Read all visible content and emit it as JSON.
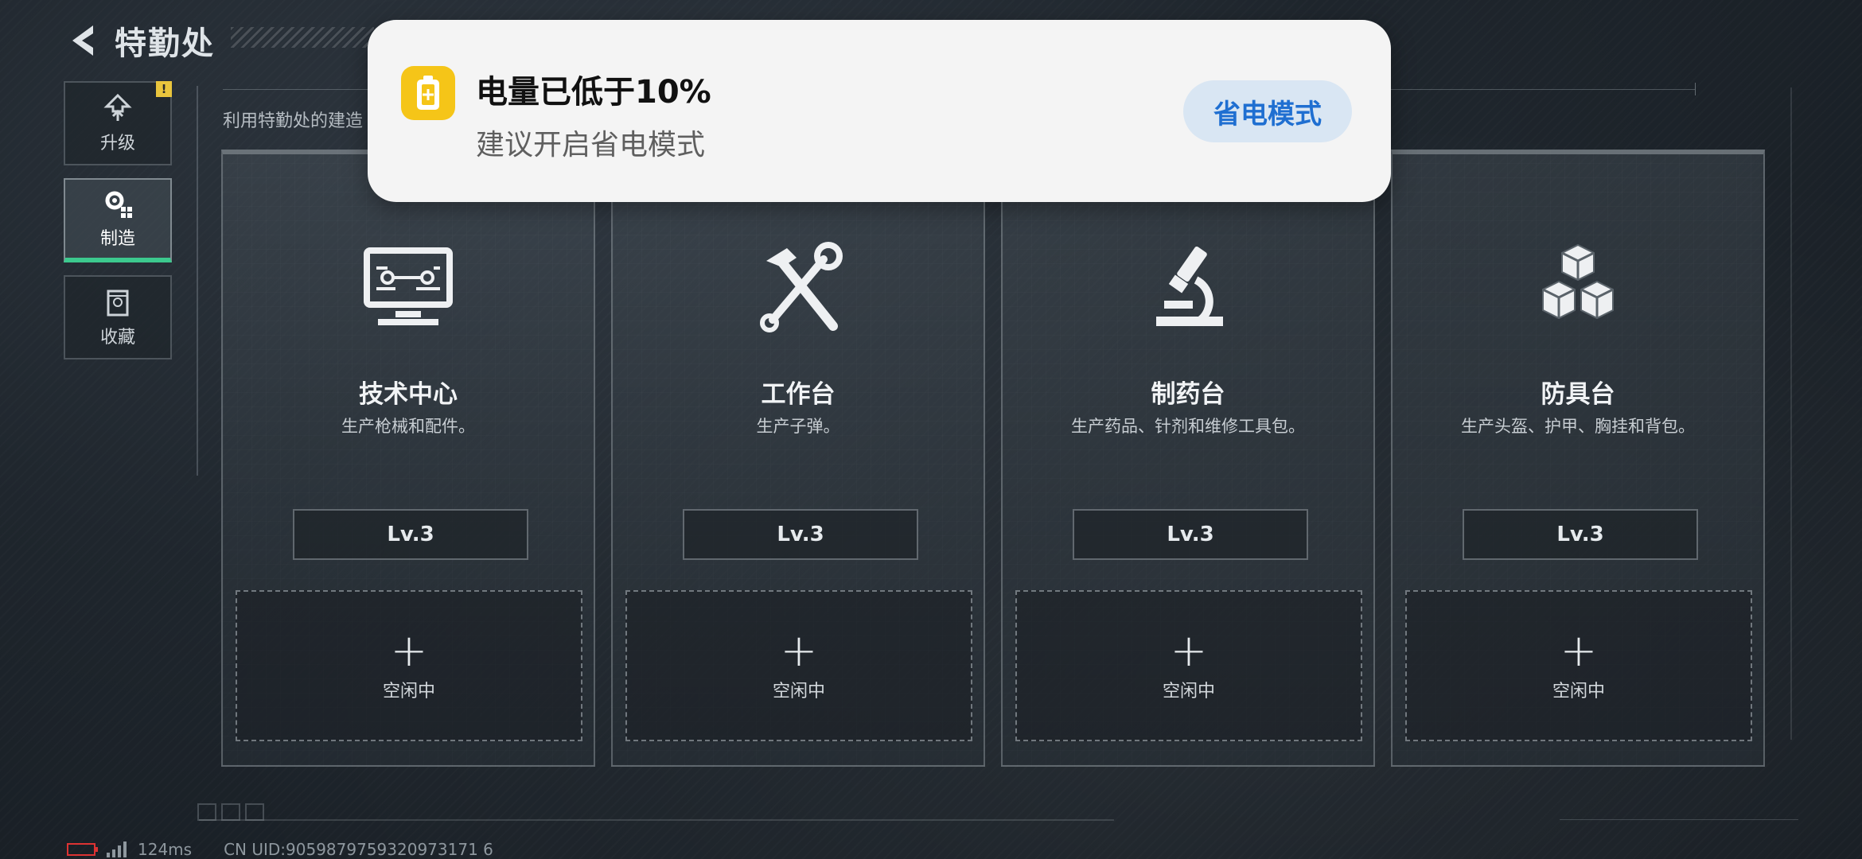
{
  "header": {
    "title": "特勤处"
  },
  "sidebar": {
    "items": [
      {
        "label": "升级",
        "badge": "!"
      },
      {
        "label": "制造"
      },
      {
        "label": "收藏"
      }
    ]
  },
  "description": "利用特勤处的建造",
  "cards": [
    {
      "name": "技术中心",
      "desc": "生产枪械和配件。",
      "level": "Lv.3",
      "slot": "空闲中",
      "icon": "monitor-circuit-icon"
    },
    {
      "name": "工作台",
      "desc": "生产子弹。",
      "level": "Lv.3",
      "slot": "空闲中",
      "icon": "hammer-wrench-icon"
    },
    {
      "name": "制药台",
      "desc": "生产药品、针剂和维修工具包。",
      "level": "Lv.3",
      "slot": "空闲中",
      "icon": "microscope-icon"
    },
    {
      "name": "防具台",
      "desc": "生产头盔、护甲、胸挂和背包。",
      "level": "Lv.3",
      "slot": "空闲中",
      "icon": "cubes-icon"
    }
  ],
  "footer": {
    "latency": "124ms",
    "uid": "CN UID:9059879759320973171 6"
  },
  "notification": {
    "title": "电量已低于10%",
    "subtitle": "建议开启省电模式",
    "button": "省电模式",
    "accent": "#1f6fd1",
    "icon_color": "#f5c518"
  },
  "colors": {
    "active_indicator": "#3cc98e",
    "warning_badge": "#e9c53d"
  }
}
